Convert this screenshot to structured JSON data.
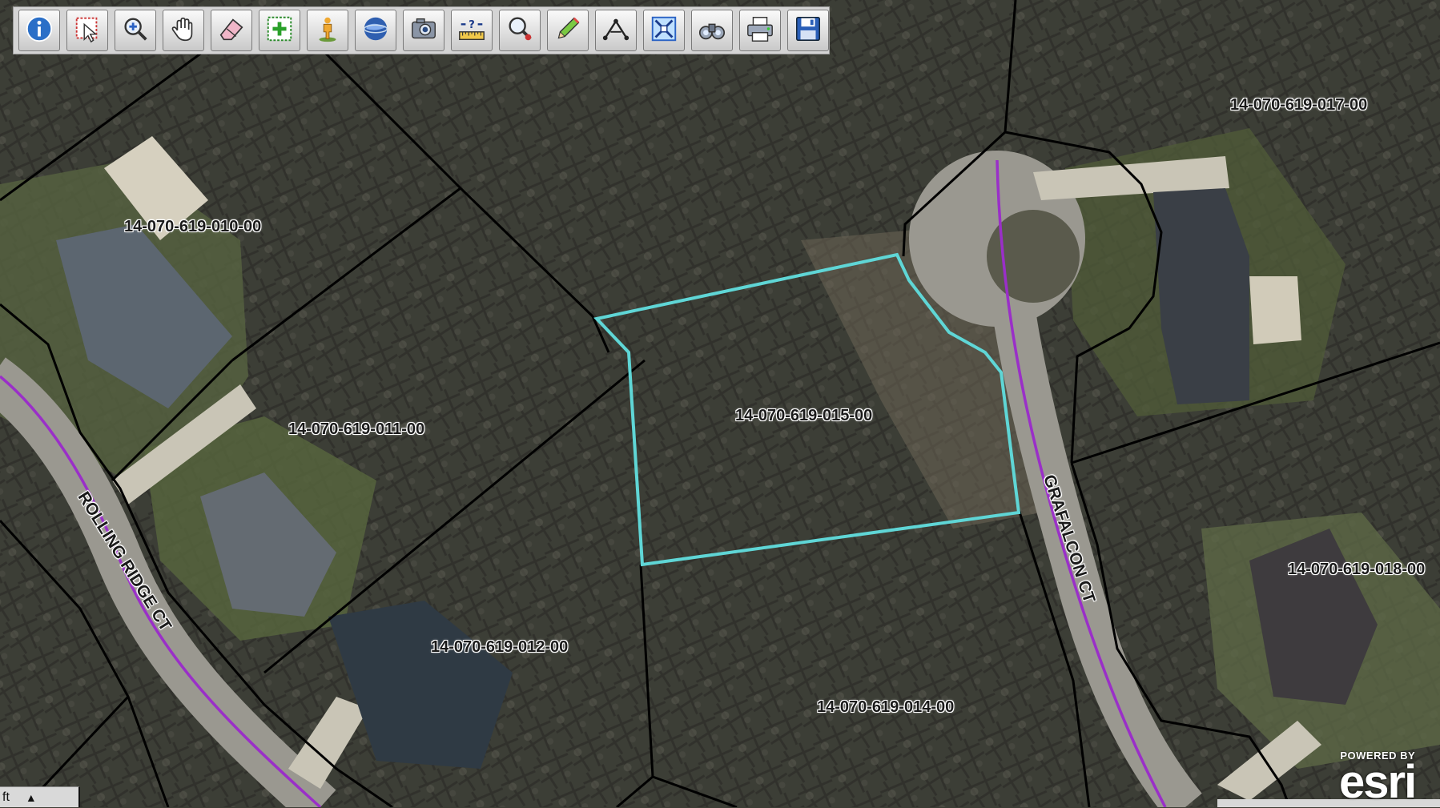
{
  "toolbar": {
    "tools": [
      {
        "icon": "info-icon",
        "label": "Identify"
      },
      {
        "icon": "select-icon",
        "label": "Select"
      },
      {
        "icon": "zoom-in-icon",
        "label": "Zoom In"
      },
      {
        "icon": "pan-hand-icon",
        "label": "Pan"
      },
      {
        "icon": "eraser-icon",
        "label": "Clear"
      },
      {
        "icon": "select-parcels-icon",
        "label": "Select Parcels"
      },
      {
        "icon": "street-view-icon",
        "label": "Street View"
      },
      {
        "icon": "globe-icon",
        "label": "Full Extent"
      },
      {
        "icon": "camera-icon",
        "label": "Photo"
      },
      {
        "icon": "measure-icon",
        "label": "Measure"
      },
      {
        "icon": "find-icon",
        "label": "Find"
      },
      {
        "icon": "pencil-icon",
        "label": "Draw"
      },
      {
        "icon": "buffer-icon",
        "label": "Buffer"
      },
      {
        "icon": "zoom-extent-icon",
        "label": "Zoom Extent"
      },
      {
        "icon": "binoculars-icon",
        "label": "Search"
      },
      {
        "icon": "print-icon",
        "label": "Print"
      },
      {
        "icon": "save-icon",
        "label": "Save"
      }
    ]
  },
  "map": {
    "parcels": [
      {
        "id": "p010",
        "label": "14-070-619-010-00"
      },
      {
        "id": "p011",
        "label": "14-070-619-011-00"
      },
      {
        "id": "p012",
        "label": "14-070-619-012-00"
      },
      {
        "id": "p014",
        "label": "14-070-619-014-00"
      },
      {
        "id": "p015",
        "label": "14-070-619-015-00",
        "selected": true
      },
      {
        "id": "p017",
        "label": "14-070-619-017-00"
      },
      {
        "id": "p018",
        "label": "14-070-619-018-00"
      }
    ],
    "roads": [
      {
        "id": "rolling",
        "label": "ROLLING RIDGE CT"
      },
      {
        "id": "grafalcon",
        "label": "GRAFALCON CT"
      }
    ],
    "colors": {
      "parcel_line": "#000000",
      "selected_parcel": "#5fd6d6",
      "road_centerline": "#9a2fc8",
      "road_surface": "#9a9890"
    }
  },
  "scalebar": {
    "unit": "ft"
  },
  "attribution": {
    "powered": "POWERED BY",
    "logo": "esri"
  }
}
